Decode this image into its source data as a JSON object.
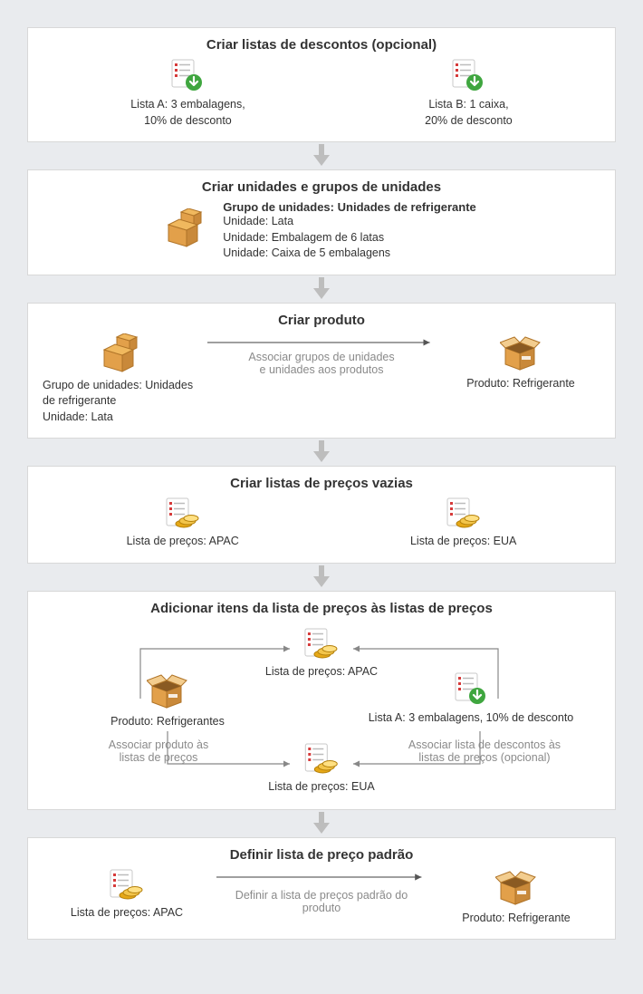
{
  "step1": {
    "title": "Criar listas de descontos (opcional)",
    "left_line1": "Lista A: 3 embalagens,",
    "left_line2": "10% de desconto",
    "right_line1": "Lista B: 1 caixa,",
    "right_line2": "20% de desconto"
  },
  "step2": {
    "title": "Criar unidades e grupos de unidades",
    "group_label": "Grupo de unidades:",
    "group_value": "Unidades de refrigerante",
    "unit1": "Unidade: Lata",
    "unit2": "Unidade: Embalagem de 6 latas",
    "unit3": "Unidade: Caixa de 5 embalagens"
  },
  "step3": {
    "title": "Criar produto",
    "left_line1": "Grupo de unidades: Unidades",
    "left_line2": "de refrigerante",
    "left_line3": "Unidade: Lata",
    "hint_line1": "Associar grupos de unidades",
    "hint_line2": "e unidades aos produtos",
    "right": "Produto: Refrigerante"
  },
  "step4": {
    "title": "Criar listas de preços vazias",
    "left": "Lista de preços: APAC",
    "right": "Lista de preços: EUA"
  },
  "step5": {
    "title": "Adicionar itens da lista de preços às listas de preços",
    "apac": "Lista de preços: APAC",
    "eua": "Lista de preços: EUA",
    "prod": "Produto: Refrigerantes",
    "disc": "Lista A: 3 embalagens, 10% de desconto",
    "hint_left_line1": "Associar produto às",
    "hint_left_line2": "listas de preços",
    "hint_right_line1": "Associar lista de descontos às",
    "hint_right_line2": "listas de preços (opcional)"
  },
  "step6": {
    "title": "Definir lista de preço padrão",
    "left": "Lista de preços: APAC",
    "hint_line1": "Definir a lista de preços padrão do",
    "hint_line2": "produto",
    "right": "Produto: Refrigerante"
  }
}
